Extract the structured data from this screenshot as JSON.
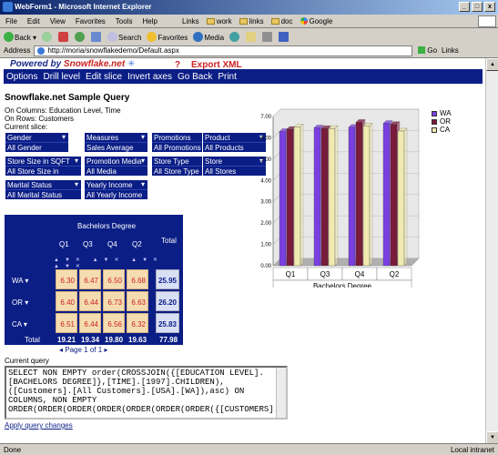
{
  "window": {
    "title": "WebForm1 - Microsoft Internet Explorer"
  },
  "menubar": {
    "items": [
      "File",
      "Edit",
      "View",
      "Favorites",
      "Tools",
      "Help"
    ]
  },
  "links_bar": {
    "label": "Links",
    "items": [
      "work",
      "links",
      "doc",
      "Google"
    ]
  },
  "toolbar": {
    "back": "Back",
    "search": "Search",
    "favorites": "Favorites",
    "media": "Media"
  },
  "address": {
    "label": "Address",
    "url": "http://moria/snowflakedemo/Default.aspx",
    "go": "Go",
    "links": "Links"
  },
  "header": {
    "powered_by": "Powered by",
    "brand": "Snowflake.net",
    "help": "?",
    "export": "Export XML"
  },
  "nav": {
    "items": [
      "Options",
      "Drill level",
      "Edit slice",
      "Invert axes",
      "Go Back",
      "Print"
    ]
  },
  "query": {
    "title": "Snowflake.net Sample Query",
    "columns": "On Columns: Education Level, Time",
    "rows": "On Rows: Customers",
    "slice": "Current slice:"
  },
  "slicers": [
    {
      "name": "Gender",
      "value": "All Gender"
    },
    {
      "name": "Measures",
      "value": "Sales Average"
    },
    {
      "name": "Promotions",
      "value": "All Promotions"
    },
    {
      "name": "Product",
      "value": "All Products"
    },
    {
      "name": "Store Size in SQFT",
      "value": "All Store Size in SQFT"
    },
    {
      "name": "Promotion Media",
      "value": "All Media"
    },
    {
      "name": "Store Type",
      "value": "All Store Type"
    },
    {
      "name": "Store",
      "value": "All Stores"
    },
    {
      "name": "Marital Status",
      "value": "All Marital Status"
    },
    {
      "name": "Yearly Income",
      "value": "All Yearly Income"
    }
  ],
  "pivot": {
    "col_group": "Bachelors Degree",
    "columns": [
      "Q1",
      "Q3",
      "Q4",
      "Q2"
    ],
    "total_label": "Total",
    "rows": [
      {
        "label": "WA",
        "values": [
          "6.30",
          "6.47",
          "6.50",
          "6.68"
        ],
        "total": "25.95"
      },
      {
        "label": "OR",
        "values": [
          "6.40",
          "6.44",
          "6.73",
          "6.63"
        ],
        "total": "26.20"
      },
      {
        "label": "CA",
        "values": [
          "6.51",
          "6.44",
          "6.56",
          "6.32"
        ],
        "total": "25.83"
      }
    ],
    "totals": {
      "label": "Total",
      "values": [
        "19.21",
        "19.34",
        "19.80",
        "19.63"
      ],
      "total": "77.98"
    },
    "pager": {
      "prefix": "Page",
      "current": "1",
      "of": "of",
      "total": "1"
    }
  },
  "chart_data": {
    "type": "bar",
    "categories": [
      "Q1",
      "Q3",
      "Q4",
      "Q2"
    ],
    "xlabel": "Bachelors Degree",
    "ylim": [
      0,
      7
    ],
    "yticks": [
      "0.00",
      "1.00",
      "2.00",
      "3.00",
      "4.00",
      "5.00",
      "6.00",
      "7.00"
    ],
    "series": [
      {
        "name": "WA",
        "values": [
          6.3,
          6.47,
          6.5,
          6.68
        ],
        "color": "#7a3fe0"
      },
      {
        "name": "OR",
        "values": [
          6.4,
          6.44,
          6.73,
          6.63
        ],
        "color": "#7a1a3a"
      },
      {
        "name": "CA",
        "values": [
          6.51,
          6.44,
          6.56,
          6.32
        ],
        "color": "#f0eab0"
      }
    ],
    "legend_position": "top-right"
  },
  "mdx": {
    "label": "Current query",
    "text": "SELECT NON EMPTY order(CROSSJOIN({[EDUCATION LEVEL].[BACHELORS DEGREE]},[TIME].[1997].CHILDREN),([Customers].[All Customers].[USA].[WA]),asc) ON COLUMNS, NON EMPTY ORDER(ORDER(ORDER(ORDER(ORDER(ORDER(ORDER({[CUSTOMERS].",
    "apply": "Apply query changes"
  },
  "status": {
    "text": "Done",
    "zone": "Local intranet"
  }
}
